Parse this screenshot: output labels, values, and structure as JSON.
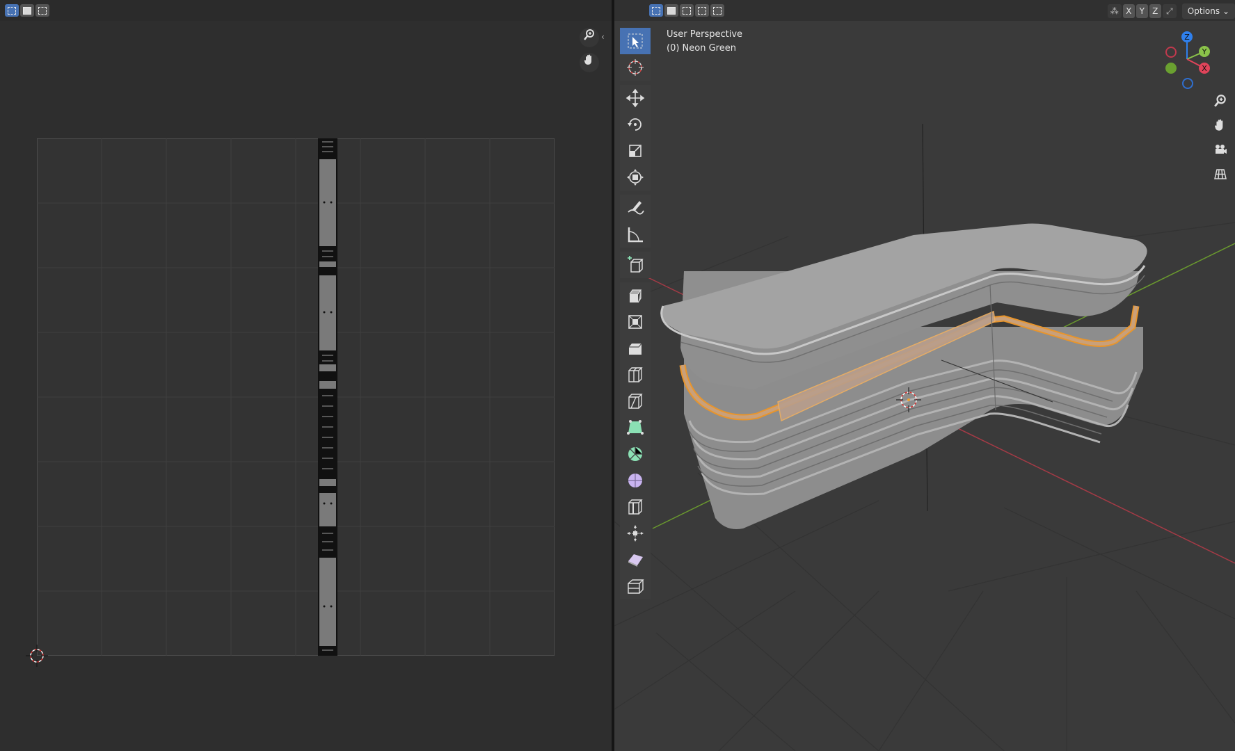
{
  "uv_editor": {
    "header": {
      "select_modes": [
        "select-new",
        "select-extend",
        "select-subtract"
      ]
    },
    "nav": {
      "zoom_icon": "zoom-icon",
      "pan_icon": "hand-icon",
      "collapse_icon": "chevron-left-icon"
    }
  },
  "viewport": {
    "header": {
      "select_modes": [
        "select-new",
        "select-extend",
        "select-subtract",
        "select-invert",
        "select-intersect"
      ],
      "mirror_axes": [
        "X",
        "Y",
        "Z"
      ],
      "options_label": "Options",
      "options_chevron": "⌄"
    },
    "info": {
      "line1": "User Perspective",
      "line2": "(0) Neon Green"
    },
    "gizmo": {
      "z": "Z",
      "y": "Y",
      "x": "X"
    },
    "colors": {
      "x_axis": "#e0445a",
      "y_axis": "#8bc34a",
      "z_axis": "#2f80ed",
      "selection": "#e8952c",
      "active_tool": "#4772b3"
    },
    "tools": [
      "select-box",
      "cursor",
      "move",
      "rotate",
      "scale",
      "transform",
      "annotate",
      "measure",
      "add-cube",
      "extrude-region",
      "inset-faces",
      "bevel",
      "loop-cut",
      "knife",
      "poly-build",
      "spin",
      "smooth",
      "edge-slide",
      "shrink-fatten",
      "shear",
      "rip-region"
    ]
  }
}
